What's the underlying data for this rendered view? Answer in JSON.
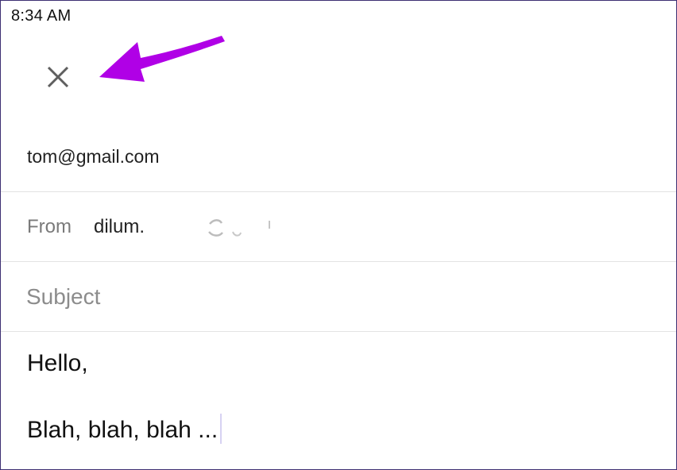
{
  "status_bar": {
    "time": "8:34 AM"
  },
  "toolbar": {
    "close_icon": "close-icon"
  },
  "annotation": {
    "arrow_color": "#b000e6"
  },
  "compose": {
    "to": "tom@gmail.com",
    "from_label": "From",
    "from_value": "dilum.",
    "subject_placeholder": "Subject",
    "body_lines": [
      "Hello,",
      "Blah, blah, blah ..."
    ]
  }
}
